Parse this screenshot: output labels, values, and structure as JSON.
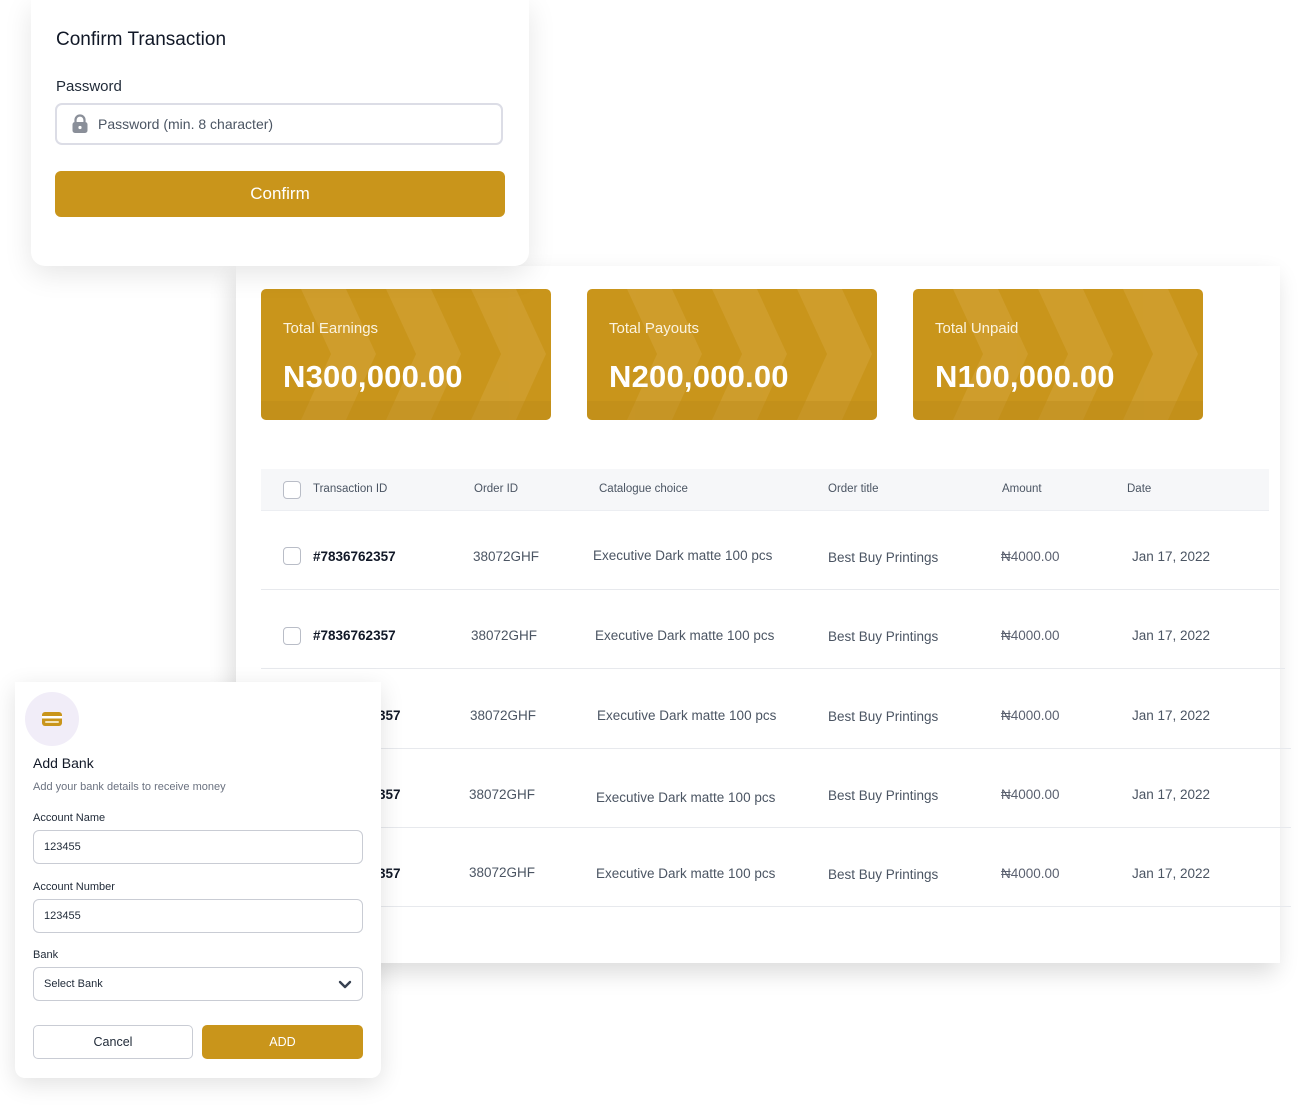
{
  "confirm": {
    "title": "Confirm Transaction",
    "password_label": "Password",
    "password_placeholder": "Password (min. 8 character)",
    "confirm_label": "Confirm"
  },
  "stats": [
    {
      "label": "Total Earnings",
      "value": "N300,000.00"
    },
    {
      "label": "Total Payouts",
      "value": "N200,000.00"
    },
    {
      "label": "Total Unpaid",
      "value": "N100,000.00"
    }
  ],
  "table": {
    "headers": [
      "Transaction ID",
      "Order ID",
      "Catalogue choice",
      "Order title",
      "Amount",
      "Date"
    ],
    "rows": [
      {
        "transaction_id": "#7836762357",
        "order_id": "38072GHF",
        "catalogue": "Executive Dark matte 100 pcs",
        "title": "Best Buy Printings",
        "amount": "₦4000.00",
        "date": "Jan 17, 2022"
      },
      {
        "transaction_id": "#7836762357",
        "order_id": "38072GHF",
        "catalogue": "Executive Dark matte 100 pcs",
        "title": "Best Buy Printings",
        "amount": "₦4000.00",
        "date": "Jan 17, 2022"
      },
      {
        "transaction_id": "357",
        "order_id": "38072GHF",
        "catalogue": "Executive Dark matte 100 pcs",
        "title": "Best Buy Printings",
        "amount": "₦4000.00",
        "date": "Jan 17, 2022"
      },
      {
        "transaction_id": "357",
        "order_id": "38072GHF",
        "catalogue": "Executive Dark matte 100 pcs",
        "title": "Best Buy Printings",
        "amount": "₦4000.00",
        "date": "Jan 17, 2022"
      },
      {
        "transaction_id": "357",
        "order_id": "38072GHF",
        "catalogue": "Executive Dark matte 100 pcs",
        "title": "Best Buy Printings",
        "amount": "₦4000.00",
        "date": "Jan 17, 2022"
      }
    ]
  },
  "bank": {
    "icon": "card-icon",
    "title": "Add Bank",
    "subtitle": "Add your bank details to receive money",
    "account_name_label": "Account Name",
    "account_name_value": "123455",
    "account_number_label": "Account Number",
    "account_number_value": "123455",
    "bank_label": "Bank",
    "bank_select_value": "Select Bank",
    "cancel_label": "Cancel",
    "add_label": "ADD"
  },
  "colors": {
    "accent": "#c9951b",
    "accent_dark": "#b8861a"
  }
}
